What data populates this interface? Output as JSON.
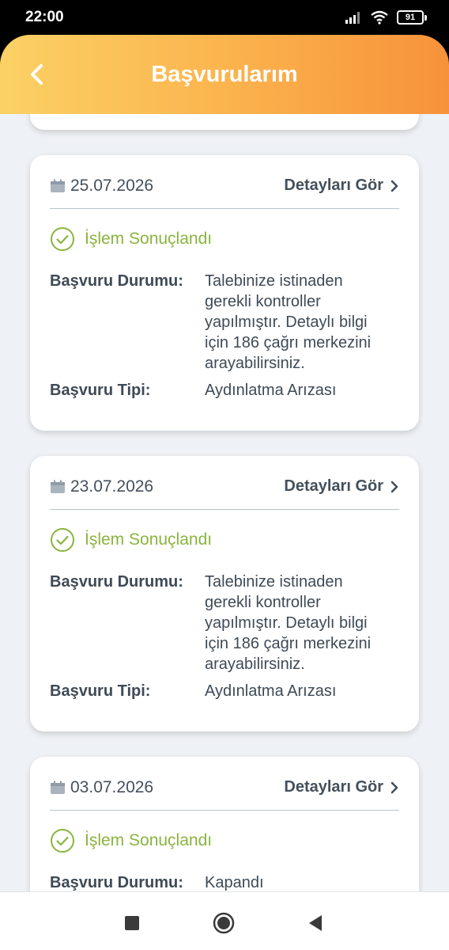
{
  "status_bar": {
    "time": "22:00",
    "battery": "91"
  },
  "header": {
    "title": "Başvurularım"
  },
  "labels": {
    "details": "Detayları Gör",
    "status_label": "Başvuru Durumu:",
    "type_label": "Başvuru Tipi:"
  },
  "applications": [
    {
      "date": "25.07.2026",
      "status": "İşlem Sonuçlandı",
      "durum": "Talebinize istinaden gerekli kontroller yapılmıştır. Detaylı bilgi için 186 çağrı merkezini arayabilirsiniz.",
      "tip": "Aydınlatma Arızası"
    },
    {
      "date": "23.07.2026",
      "status": "İşlem Sonuçlandı",
      "durum": "Talebinize istinaden gerekli kontroller yapılmıştır. Detaylı bilgi için 186 çağrı merkezini arayabilirsiniz.",
      "tip": "Aydınlatma Arızası"
    },
    {
      "date": "03.07.2026",
      "status": "İşlem Sonuçlandı",
      "durum": "Kapandı",
      "tip": ""
    }
  ],
  "colors": {
    "header_start": "#fbd165",
    "header_end": "#f7923a",
    "status_green": "#8ab43e",
    "text_dark": "#3e4a56"
  }
}
